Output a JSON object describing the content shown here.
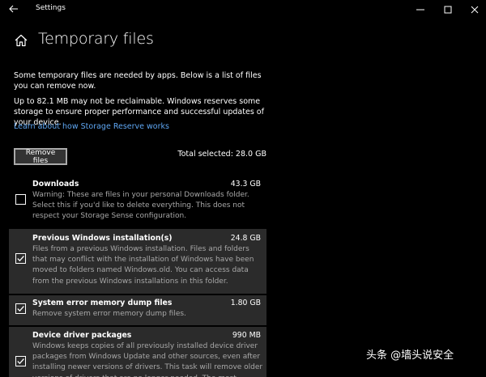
{
  "window": {
    "title": "Settings",
    "back_icon": "arrow-left-icon",
    "controls": [
      "minimize-icon",
      "maximize-icon",
      "close-icon"
    ]
  },
  "page": {
    "home_icon": "home-icon",
    "title": "Temporary files",
    "intro": "Some temporary files are needed by apps. Below is a list of files you can remove now.",
    "reserve_note": "Up to 82.1 MB may not be reclaimable. Windows reserves some storage to ensure proper performance and successful updates of your device.",
    "link": "Learn about how Storage Reserve works",
    "remove_button": "Remove files",
    "total_selected": "Total selected: 28.0 GB"
  },
  "items": [
    {
      "name": "Downloads",
      "size": "43.3 GB",
      "description": "Warning: These are files in your personal Downloads folder. Select this if you'd like to delete everything. This does not respect your Storage Sense configuration.",
      "checked": false
    },
    {
      "name": "Previous Windows installation(s)",
      "size": "24.8 GB",
      "description": "Files from a previous Windows installation.  Files and folders that may conflict with the installation of Windows have been moved to folders named Windows.old.  You can access data from the previous Windows installations in this folder.",
      "checked": true
    },
    {
      "name": "System error memory dump files",
      "size": "1.80 GB",
      "description": "Remove system error memory dump files.",
      "checked": true
    },
    {
      "name": "Device driver packages",
      "size": "990 MB",
      "description": "Windows keeps copies of all previously installed device driver packages from Windows Update and other sources, even after installing newer versions of drivers. This task will remove older versions of drivers that are no longer needed. The most current",
      "checked": true
    }
  ],
  "watermark": "头条 @墙头说安全",
  "colors": {
    "background": "#000000",
    "link": "#5ea6f2",
    "row_highlight": "#2b2b2b",
    "secondary_text": "#a8a8a8"
  }
}
